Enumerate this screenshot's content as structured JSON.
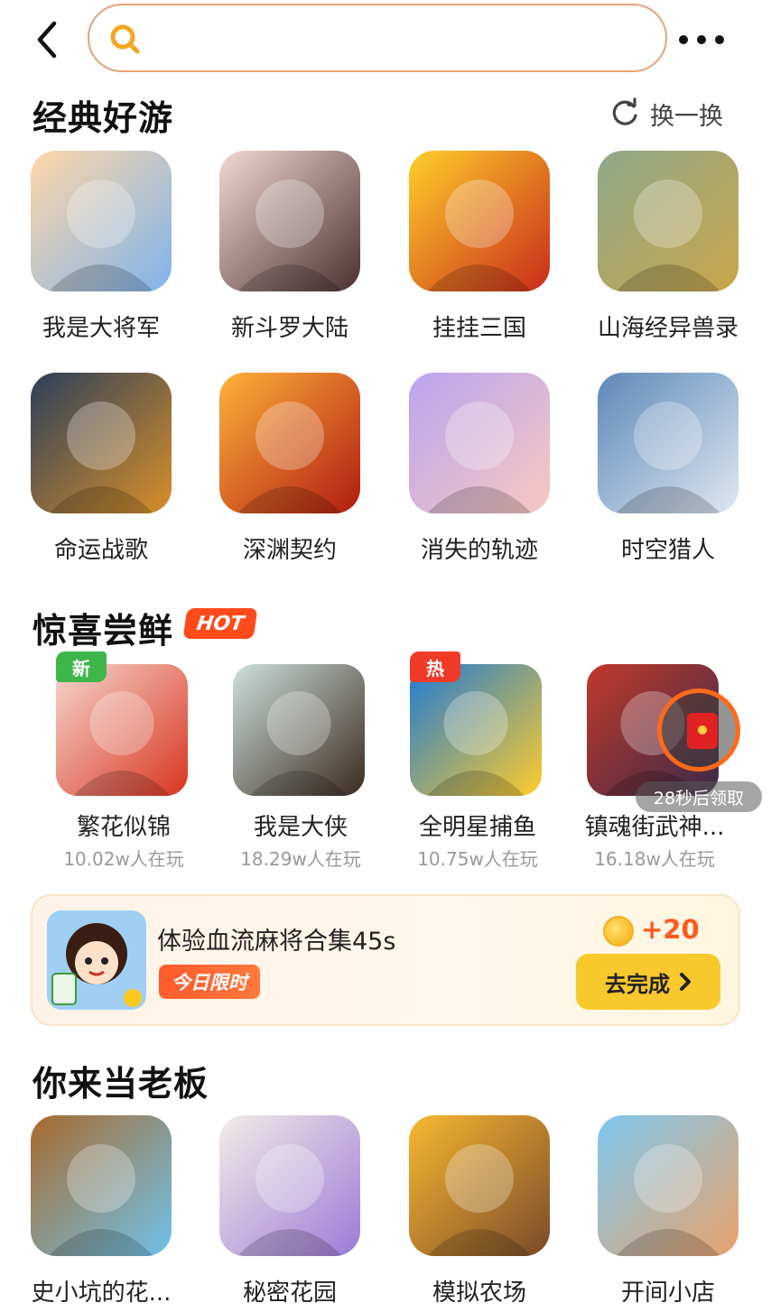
{
  "search": {
    "placeholder": ""
  },
  "classic": {
    "title": "经典好游",
    "refresh_label": "换一换",
    "apps": [
      {
        "name": "我是大将军",
        "colors": [
          "#ffd7a8",
          "#7fb3ea"
        ]
      },
      {
        "name": "新斗罗大陆",
        "colors": [
          "#f3d8d3",
          "#4a3030"
        ]
      },
      {
        "name": "挂挂三国",
        "colors": [
          "#ffcf2a",
          "#c92a1a"
        ]
      },
      {
        "name": "山海经异兽录",
        "colors": [
          "#8fa88a",
          "#c9a64a"
        ]
      },
      {
        "name": "命运战歌",
        "colors": [
          "#2b3f5a",
          "#d98f2a"
        ]
      },
      {
        "name": "深渊契约",
        "colors": [
          "#ffb23a",
          "#b01a10"
        ]
      },
      {
        "name": "消失的轨迹",
        "colors": [
          "#b9a4f0",
          "#f8c8c0"
        ]
      },
      {
        "name": "时空猎人",
        "colors": [
          "#5d88b8",
          "#dfe8f2"
        ]
      }
    ]
  },
  "trial": {
    "title": "惊喜尝鲜",
    "hot_badge": "HOT",
    "apps": [
      {
        "name": "繁花似锦",
        "players": "10.02w人在玩",
        "tag": "新",
        "tag_color": "#3fb64a",
        "colors": [
          "#f6d7cf",
          "#d8351f"
        ]
      },
      {
        "name": "我是大侠",
        "players": "18.29w人在玩",
        "tag": "",
        "tag_color": "",
        "colors": [
          "#cfe0dd",
          "#3a2a20"
        ]
      },
      {
        "name": "全明星捕鱼",
        "players": "10.75w人在玩",
        "tag": "热",
        "tag_color": "#f03a2a",
        "colors": [
          "#1e7ad6",
          "#ffcc2a"
        ]
      },
      {
        "name": "镇魂街武神...",
        "players": "16.18w人在玩",
        "tag": "",
        "tag_color": "",
        "colors": [
          "#c23a2a",
          "#3a2a4a"
        ]
      }
    ],
    "timer_text": "28秒后领取"
  },
  "task": {
    "title": "体验血流麻将合集45s",
    "limit_label": "今日限时",
    "reward": "+20",
    "button_label": "去完成"
  },
  "boss": {
    "title": "你来当老板",
    "apps": [
      {
        "name": "史小坑的花...",
        "colors": [
          "#a86a2e",
          "#6fc2ea"
        ]
      },
      {
        "name": "秘密花园",
        "colors": [
          "#f2ede6",
          "#9c7ad8"
        ]
      },
      {
        "name": "模拟农场",
        "colors": [
          "#f8b830",
          "#7a4a2a"
        ]
      },
      {
        "name": "开间小店",
        "colors": [
          "#7ec8f0",
          "#e8a26a"
        ]
      }
    ]
  }
}
